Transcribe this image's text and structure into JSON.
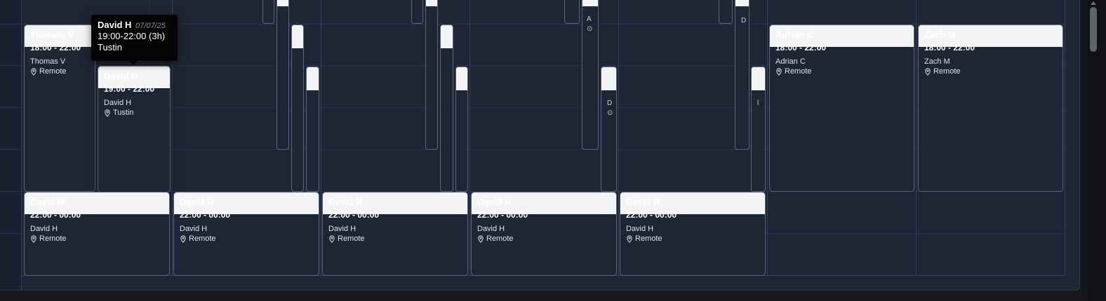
{
  "tooltip": {
    "name": "David H",
    "date": "07/07/25",
    "time": "19:00-22:00 (3h)",
    "location": "Tustin"
  },
  "shifts_top": [
    {
      "name": "Thomas V",
      "time": "18:00 - 22:00",
      "person": "Thomas V",
      "location": "Remote"
    },
    {
      "name": "David H",
      "time": "19:00 - 22:00",
      "person": "David H",
      "location": "Tustin"
    },
    {
      "name": "Adrian C",
      "time": "18:00 - 22:00",
      "person": "Adrian C",
      "location": "Remote"
    },
    {
      "name": "Zach M",
      "time": "18:00 - 22:00",
      "person": "Zach M",
      "location": "Remote"
    }
  ],
  "shifts_bottom": [
    {
      "name": "David H",
      "time": "22:00 - 00:00",
      "person": "David H",
      "location": "Remote"
    },
    {
      "name": "David H",
      "time": "22:00 - 00:00",
      "person": "David H",
      "location": "Remote"
    },
    {
      "name": "David H",
      "time": "22:00 - 00:00",
      "person": "David H",
      "location": "Remote"
    },
    {
      "name": "David H",
      "time": "22:00 - 00:00",
      "person": "David H",
      "location": "Remote"
    },
    {
      "name": "David H",
      "time": "22:00 - 00:00",
      "person": "David H",
      "location": "Remote"
    }
  ],
  "sliver_marks": {
    "a": "A",
    "loc": "⊙",
    "d": "D",
    "l": "l"
  },
  "icons": {
    "location": "map-pin-icon"
  },
  "colors": {
    "background": "#1e2535",
    "card_header": "#f3f4f6",
    "card_border": "#5d6678",
    "tooltip": "#050505"
  }
}
